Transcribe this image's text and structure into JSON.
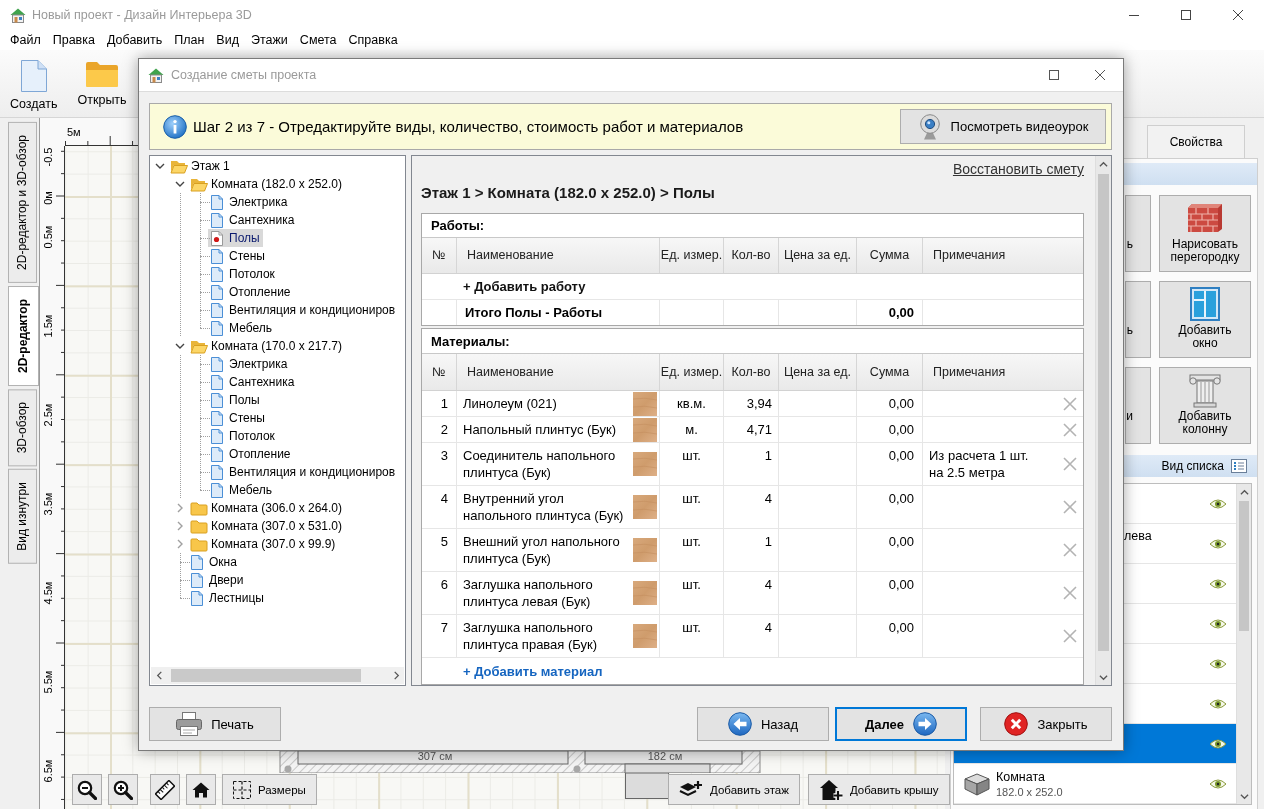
{
  "app": {
    "title": "Новый проект - Дизайн Интерьера 3D",
    "menu": [
      "Файл",
      "Правка",
      "Добавить",
      "План",
      "Вид",
      "Этажи",
      "Смета",
      "Справка"
    ],
    "toolbar": [
      {
        "kind": "new",
        "label": "Создать"
      },
      {
        "kind": "open",
        "label": "Открыть"
      }
    ],
    "view_tabs": [
      {
        "label": "2D-редактор и 3D-обзор",
        "selected": false
      },
      {
        "label": "2D-редактор",
        "selected": true
      },
      {
        "label": "3D-обзор",
        "selected": false
      },
      {
        "label": "Вид изнутри",
        "selected": false
      }
    ],
    "ruler": {
      "top": [
        "5м"
      ],
      "side": [
        "-0.5",
        "0м",
        "0.5м",
        "1.5м",
        "2.5м",
        "3.5м",
        "4.5м",
        "5.5м",
        "6.5м"
      ]
    },
    "plan_dimensions": [
      "307 см",
      "182 см"
    ],
    "canvas_tools": [
      {
        "kind": "zoom_out"
      },
      {
        "kind": "zoom_in"
      },
      {
        "kind": "ruler"
      },
      {
        "kind": "home"
      },
      {
        "kind": "dimensions",
        "label": "Размеры"
      }
    ],
    "floor_actions": [
      {
        "kind": "add_floor",
        "label": "Добавить этаж"
      },
      {
        "kind": "add_roof",
        "label": "Добавить крышу"
      }
    ]
  },
  "side_panel": {
    "tabs": [
      {
        "label": "Свойства",
        "selected": false
      }
    ],
    "tools": [
      {
        "kind": "covered",
        "label": "ь"
      },
      {
        "kind": "partition",
        "label": "Нарисовать перегородку"
      },
      {
        "kind": "covered",
        "label": "ь"
      },
      {
        "kind": "window",
        "label": "Добавить окно"
      },
      {
        "kind": "covered",
        "label": "и"
      },
      {
        "kind": "column",
        "label": "Добавить колонну"
      }
    ],
    "list_view": "Вид списка",
    "objects": [
      {
        "kind": "covered",
        "selected": false,
        "visible": true
      },
      {
        "kind": "covered",
        "label": "лева",
        "selected": false,
        "visible": true
      },
      {
        "kind": "covered",
        "selected": false,
        "visible": true
      },
      {
        "kind": "covered",
        "selected": false,
        "visible": true
      },
      {
        "kind": "covered",
        "selected": false,
        "visible": true
      },
      {
        "kind": "covered",
        "selected": false,
        "visible": true
      },
      {
        "kind": "covered",
        "selected": true,
        "visible": true
      },
      {
        "kind": "room",
        "label": "Комната",
        "detail": "182.0 x 252.0",
        "selected": false,
        "visible": true
      }
    ]
  },
  "dialog": {
    "title": "Создание сметы проекта",
    "banner": {
      "text": "Шаг 2 из 7 - Отредактируйте виды, количество, стоимость работ и материалов",
      "video_button": "Посмотреть видеоурок"
    },
    "tree": [
      {
        "kind": "folder",
        "label": "Этаж 1",
        "expanded": true,
        "selected": false,
        "children": [
          {
            "kind": "folder",
            "label": "Комната (182.0 x 252.0)",
            "expanded": true,
            "selected": false,
            "children": [
              {
                "kind": "doc",
                "label": "Электрика",
                "selected": false
              },
              {
                "kind": "doc",
                "label": "Сантехника",
                "selected": false
              },
              {
                "kind": "doc",
                "label": "Полы",
                "selected": true
              },
              {
                "kind": "doc",
                "label": "Стены",
                "selected": false
              },
              {
                "kind": "doc",
                "label": "Потолок",
                "selected": false
              },
              {
                "kind": "doc",
                "label": "Отопление",
                "selected": false
              },
              {
                "kind": "doc",
                "label": "Вентиляция и кондициониров",
                "selected": false
              },
              {
                "kind": "doc",
                "label": "Мебель",
                "selected": false
              }
            ]
          },
          {
            "kind": "folder",
            "label": "Комната (170.0 x 217.7)",
            "expanded": true,
            "selected": false,
            "children": [
              {
                "kind": "doc",
                "label": "Электрика",
                "selected": false
              },
              {
                "kind": "doc",
                "label": "Сантехника",
                "selected": false
              },
              {
                "kind": "doc",
                "label": "Полы",
                "selected": false
              },
              {
                "kind": "doc",
                "label": "Стены",
                "selected": false
              },
              {
                "kind": "doc",
                "label": "Потолок",
                "selected": false
              },
              {
                "kind": "doc",
                "label": "Отопление",
                "selected": false
              },
              {
                "kind": "doc",
                "label": "Вентиляция и кондициониров",
                "selected": false
              },
              {
                "kind": "doc",
                "label": "Мебель",
                "selected": false
              }
            ]
          },
          {
            "kind": "folder",
            "label": "Комната (306.0 x 264.0)",
            "expanded": false,
            "selected": false
          },
          {
            "kind": "folder",
            "label": "Комната (307.0 x 531.0)",
            "expanded": false,
            "selected": false
          },
          {
            "kind": "folder",
            "label": "Комната (307.0 x 99.9)",
            "expanded": false,
            "selected": false
          },
          {
            "kind": "doc",
            "label": "Окна",
            "selected": false
          },
          {
            "kind": "doc",
            "label": "Двери",
            "selected": false
          },
          {
            "kind": "doc",
            "label": "Лестницы",
            "selected": false
          }
        ]
      }
    ],
    "estimate": {
      "restore_link": "Восстановить смету",
      "breadcrumb": "Этаж 1 > Комната (182.0 x 252.0) > Полы",
      "works": {
        "title": "Работы:",
        "columns": [
          "№",
          "Наименование",
          "Ед. измер.",
          "Кол-во",
          "Цена за ед.",
          "Сумма",
          "Примечания"
        ],
        "add": {
          "label": "+ Добавить работу",
          "hovered": false
        },
        "total": {
          "label": "Итого Полы - Работы",
          "sum": "0,00"
        }
      },
      "materials": {
        "title": "Материалы:",
        "columns": [
          "№",
          "Наименование",
          "Ед. измер.",
          "Кол-во",
          "Цена за ед.",
          "Сумма",
          "Примечания"
        ],
        "rows": [
          {
            "no": "1",
            "name": "Линолеум (021)",
            "unit": "кв.м.",
            "qty": "3,94",
            "sum": "0,00"
          },
          {
            "no": "2",
            "name": "Напольный плинтус (Бук)",
            "unit": "м.",
            "qty": "4,71",
            "sum": "0,00"
          },
          {
            "no": "3",
            "name": "Соединитель напольного плинтуса (Бук)",
            "unit": "шт.",
            "qty": "1",
            "sum": "0,00",
            "note": "Из расчета 1 шт. на 2.5 метра"
          },
          {
            "no": "4",
            "name": "Внутренний угол напольного плинтуса (Бук)",
            "unit": "шт.",
            "qty": "4",
            "sum": "0,00"
          },
          {
            "no": "5",
            "name": "Внешний угол напольного плинтуса (Бук)",
            "unit": "шт.",
            "qty": "1",
            "sum": "0,00"
          },
          {
            "no": "6",
            "name": "Заглушка напольного плинтуса левая (Бук)",
            "unit": "шт.",
            "qty": "4",
            "sum": "0,00"
          },
          {
            "no": "7",
            "name": "Заглушка напольного плинтуса правая (Бук)",
            "unit": "шт.",
            "qty": "4",
            "sum": "0,00"
          }
        ],
        "add": {
          "label": "+ Добавить материал",
          "hovered": true
        }
      }
    },
    "buttons": [
      {
        "kind": "print",
        "label": "Печать",
        "default": false
      },
      {
        "kind": "back",
        "label": "Назад",
        "default": false
      },
      {
        "kind": "next",
        "label": "Далее",
        "default": true
      },
      {
        "kind": "close",
        "label": "Закрыть",
        "default": false
      }
    ]
  }
}
